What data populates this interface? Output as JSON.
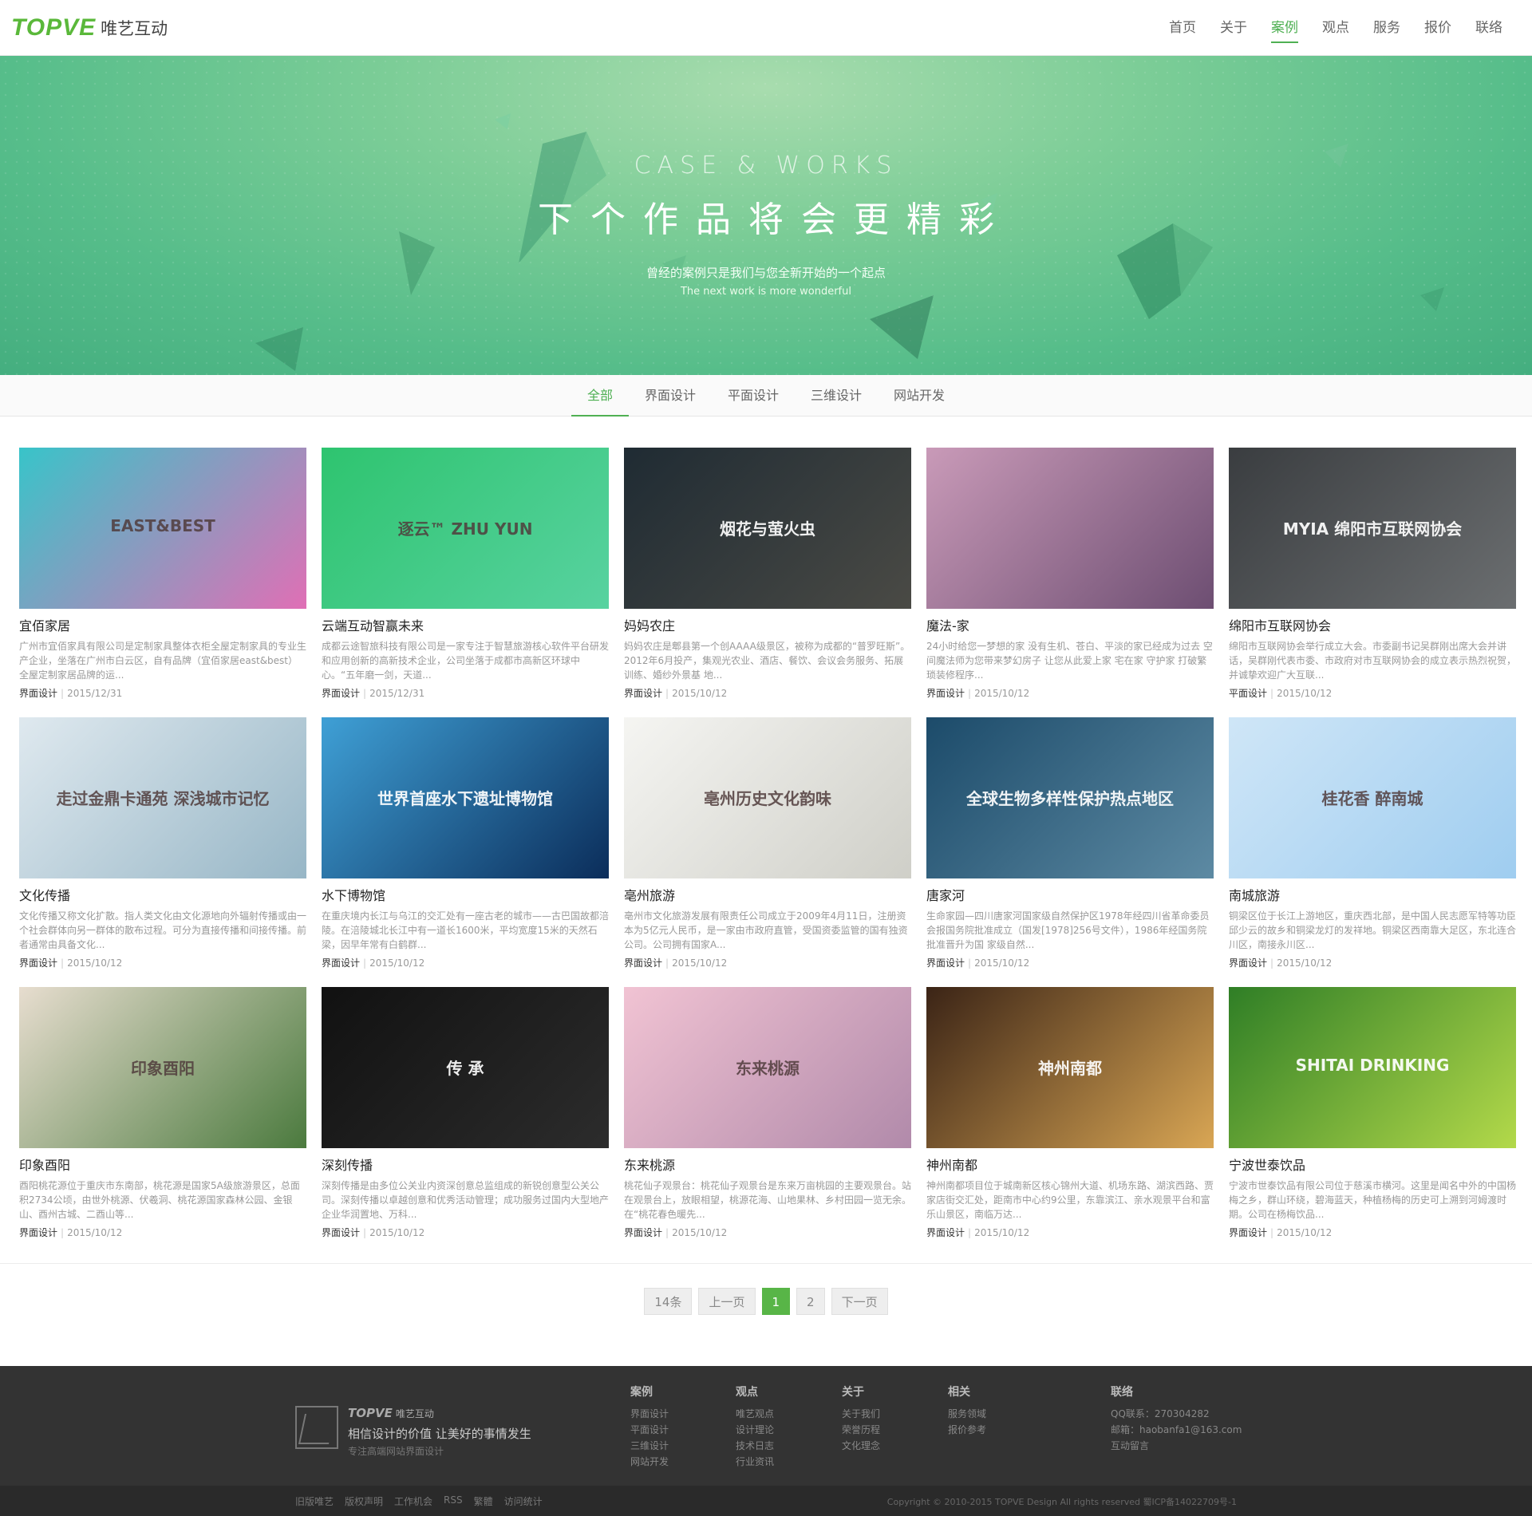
{
  "header": {
    "logo_mark": "TOPVE",
    "logo_cn": "唯艺互动",
    "nav": [
      {
        "label": "首页",
        "active": false
      },
      {
        "label": "关于",
        "active": false
      },
      {
        "label": "案例",
        "active": true
      },
      {
        "label": "观点",
        "active": false
      },
      {
        "label": "服务",
        "active": false
      },
      {
        "label": "报价",
        "active": false
      },
      {
        "label": "联络",
        "active": false
      }
    ]
  },
  "hero": {
    "en": "CASE & WORKS",
    "title": "下个作品将会更精彩",
    "sub": "曾经的案例只是我们与您全新开始的一个起点",
    "sub_en": "The next work is more wonderful"
  },
  "filter": {
    "tabs": [
      {
        "label": "全部",
        "active": true
      },
      {
        "label": "界面设计",
        "active": false
      },
      {
        "label": "平面设计",
        "active": false
      },
      {
        "label": "三维设计",
        "active": false
      },
      {
        "label": "网站开发",
        "active": false
      }
    ]
  },
  "cases": [
    {
      "title": "宜佰家居",
      "desc": "广州市宜佰家具有限公司是定制家具整体衣柜全屋定制家具的专业生产企业，坐落在广州市白云区，自有品牌（宜佰家居east&best）全屋定制家居品牌的运...",
      "category": "界面设计",
      "date": "2015/12/31",
      "thumb_text": "EAST&BEST",
      "colors": [
        "#38c4c9",
        "#e06fb5"
      ]
    },
    {
      "title": "云端互动智赢未来",
      "desc": "成都云途智旅科技有限公司是一家专注于智慧旅游核心软件平台研发和应用创新的高新技术企业，公司坐落于成都市高新区环球中心。“五年磨一剑，天道...",
      "category": "界面设计",
      "date": "2015/12/31",
      "thumb_text": "逐云™ ZHU YUN",
      "colors": [
        "#2ec46f",
        "#58d2a0"
      ]
    },
    {
      "title": "妈妈农庄",
      "desc": "妈妈农庄是郫县第一个创AAAA级景区，被称为成都的“普罗旺斯”。2012年6月投产，集观光农业、酒店、餐饮、会议会务服务、拓展训练、婚纱外景基 地...",
      "category": "界面设计",
      "date": "2015/10/12",
      "thumb_text": "烟花与萤火虫",
      "colors": [
        "#1f2b33",
        "#4a4a45"
      ]
    },
    {
      "title": "魔法-家",
      "desc": "24小时给您一梦想的家 没有生机、苍白、平淡的家已经成为过去 空间魔法师为您带来梦幻房子 让您从此爱上家 宅在家 守护家 打破繁琐装修程序...",
      "category": "界面设计",
      "date": "2015/10/12",
      "thumb_text": "",
      "colors": [
        "#c99ab8",
        "#6d4e72"
      ]
    },
    {
      "title": "绵阳市互联网协会",
      "desc": "绵阳市互联网协会举行成立大会。市委副书记吴群刚出席大会并讲话，吴群刚代表市委、市政府对市互联网协会的成立表示热烈祝贺，并诚挚欢迎广大互联...",
      "category": "平面设计",
      "date": "2015/10/12",
      "thumb_text": "MYIA 绵阳市互联网协会",
      "colors": [
        "#3a3d40",
        "#6b6e70"
      ]
    },
    {
      "title": "文化传播",
      "desc": "文化传播又称文化扩散。指人类文化由文化源地向外辐射传播或由一个社会群体向另一群体的散布过程。可分为直接传播和间接传播。前者通常由具备文化...",
      "category": "界面设计",
      "date": "2015/10/12",
      "thumb_text": "走过金鼎卡通苑 深浅城市记忆",
      "colors": [
        "#dfe9ef",
        "#97b6c6"
      ]
    },
    {
      "title": "水下博物馆",
      "desc": "在重庆境内长江与乌江的交汇处有一座古老的城市——古巴国故都涪陵。在涪陵城北长江中有一道长1600米，平均宽度15米的天然石梁，因早年常有白鹤群...",
      "category": "界面设计",
      "date": "2015/10/12",
      "thumb_text": "世界首座水下遗址博物馆",
      "colors": [
        "#3fa0d6",
        "#0b2d5a"
      ]
    },
    {
      "title": "亳州旅游",
      "desc": "亳州市文化旅游发展有限责任公司成立于2009年4月11日，注册资本为5亿元人民币，是一家由市政府直管，受国资委监管的国有独资公司。公司拥有国家A...",
      "category": "界面设计",
      "date": "2015/10/12",
      "thumb_text": "亳州历史文化韵味",
      "colors": [
        "#f5f5f2",
        "#cfcfc8"
      ]
    },
    {
      "title": "唐家河",
      "desc": "生命家园—四川唐家河国家级自然保护区1978年经四川省革命委员会报国务院批准成立（国发[1978]256号文件），1986年经国务院批准晋升为国 家级自然...",
      "category": "界面设计",
      "date": "2015/10/12",
      "thumb_text": "全球生物多样性保护热点地区",
      "colors": [
        "#1c4b6a",
        "#5d8aa3"
      ]
    },
    {
      "title": "南城旅游",
      "desc": "铜梁区位于长江上游地区，重庆西北部，是中国人民志愿军特等功臣邱少云的故乡和铜梁龙灯的发祥地。铜梁区西南靠大足区，东北连合川区，南接永川区...",
      "category": "界面设计",
      "date": "2015/10/12",
      "thumb_text": "桂花香 醉南城",
      "colors": [
        "#cfe6f7",
        "#9fcdf0"
      ]
    },
    {
      "title": "印象酉阳",
      "desc": "酉阳桃花源位于重庆市东南部，桃花源是国家5A级旅游景区，总面积2734公顷，由世外桃源、伏羲洞、桃花源国家森林公园、金银山、酉州古城、二酉山等...",
      "category": "界面设计",
      "date": "2015/10/12",
      "thumb_text": "印象酉阳",
      "colors": [
        "#e7ddcf",
        "#4b7a3e"
      ]
    },
    {
      "title": "深刻传播",
      "desc": "深刻传播是由多位公关业内资深创意总监组成的新锐创意型公关公司。深刻传播以卓越创意和优秀活动管理；成功服务过国内大型地产企业华润置地、万科...",
      "category": "界面设计",
      "date": "2015/10/12",
      "thumb_text": "传 承",
      "colors": [
        "#111111",
        "#2c2c2c"
      ]
    },
    {
      "title": "东来桃源",
      "desc": "桃花仙子观景台：桃花仙子观景台是东来万亩桃园的主要观景台。站在观景台上，放眼相望，桃源花海、山地果林、乡村田园一览无余。在“桃花春色暖先...",
      "category": "界面设计",
      "date": "2015/10/12",
      "thumb_text": "东来桃源",
      "colors": [
        "#f1c3d3",
        "#b18aaa"
      ]
    },
    {
      "title": "神州南都",
      "desc": "神州南都项目位于城南新区核心锦州大道、机场东路、湖滨西路、贾家店街交汇处，距南市中心约9公里，东靠滨江、亲水观景平台和富乐山景区，南临万达...",
      "category": "界面设计",
      "date": "2015/10/12",
      "thumb_text": "神州南都",
      "colors": [
        "#3b2416",
        "#d9a654"
      ]
    },
    {
      "title": "宁波世泰饮品",
      "desc": "宁波市世泰饮品有限公司位于慈溪市横河。这里是闻名中外的中国杨梅之乡，群山环绕，碧海蓝天，种植杨梅的历史可上溯到河姆渡时期。公司在杨梅饮品...",
      "category": "界面设计",
      "date": "2015/10/12",
      "thumb_text": "SHITAI DRINKING",
      "colors": [
        "#2f7e26",
        "#b3d94a"
      ]
    }
  ],
  "pager": {
    "total": "14条",
    "prev": "上一页",
    "pages": [
      "1",
      "2"
    ],
    "current": "1",
    "next": "下一页"
  },
  "footer": {
    "logo_mark": "TOPVE",
    "logo_cn": "唯艺互动",
    "slogan": "相信设计的价值 让美好的事情发生",
    "sub": "专注高端网站界面设计",
    "columns": [
      {
        "title": "案例",
        "links": [
          "界面设计",
          "平面设计",
          "三维设计",
          "网站开发"
        ]
      },
      {
        "title": "观点",
        "links": [
          "唯艺观点",
          "设计理论",
          "技术日志",
          "行业资讯"
        ]
      },
      {
        "title": "关于",
        "links": [
          "关于我们",
          "荣誉历程",
          "文化理念"
        ]
      },
      {
        "title": "相关",
        "links": [
          "服务领域",
          "报价参考"
        ]
      },
      {
        "title": "联络",
        "links": [
          "QQ联系：270304282",
          "邮箱：haobanfa1@163.com",
          "互动留言"
        ]
      }
    ],
    "bottom_links": [
      "旧版唯艺",
      "版权声明",
      "工作机会",
      "RSS",
      "繁體",
      "访问统计"
    ],
    "copyright": "Copyright © 2010-2015 TOPVE Design All rights reserved 蜀ICP备14022709号-1"
  },
  "theme": {
    "accent": "#4fb053",
    "footer_bg": "#333333"
  }
}
